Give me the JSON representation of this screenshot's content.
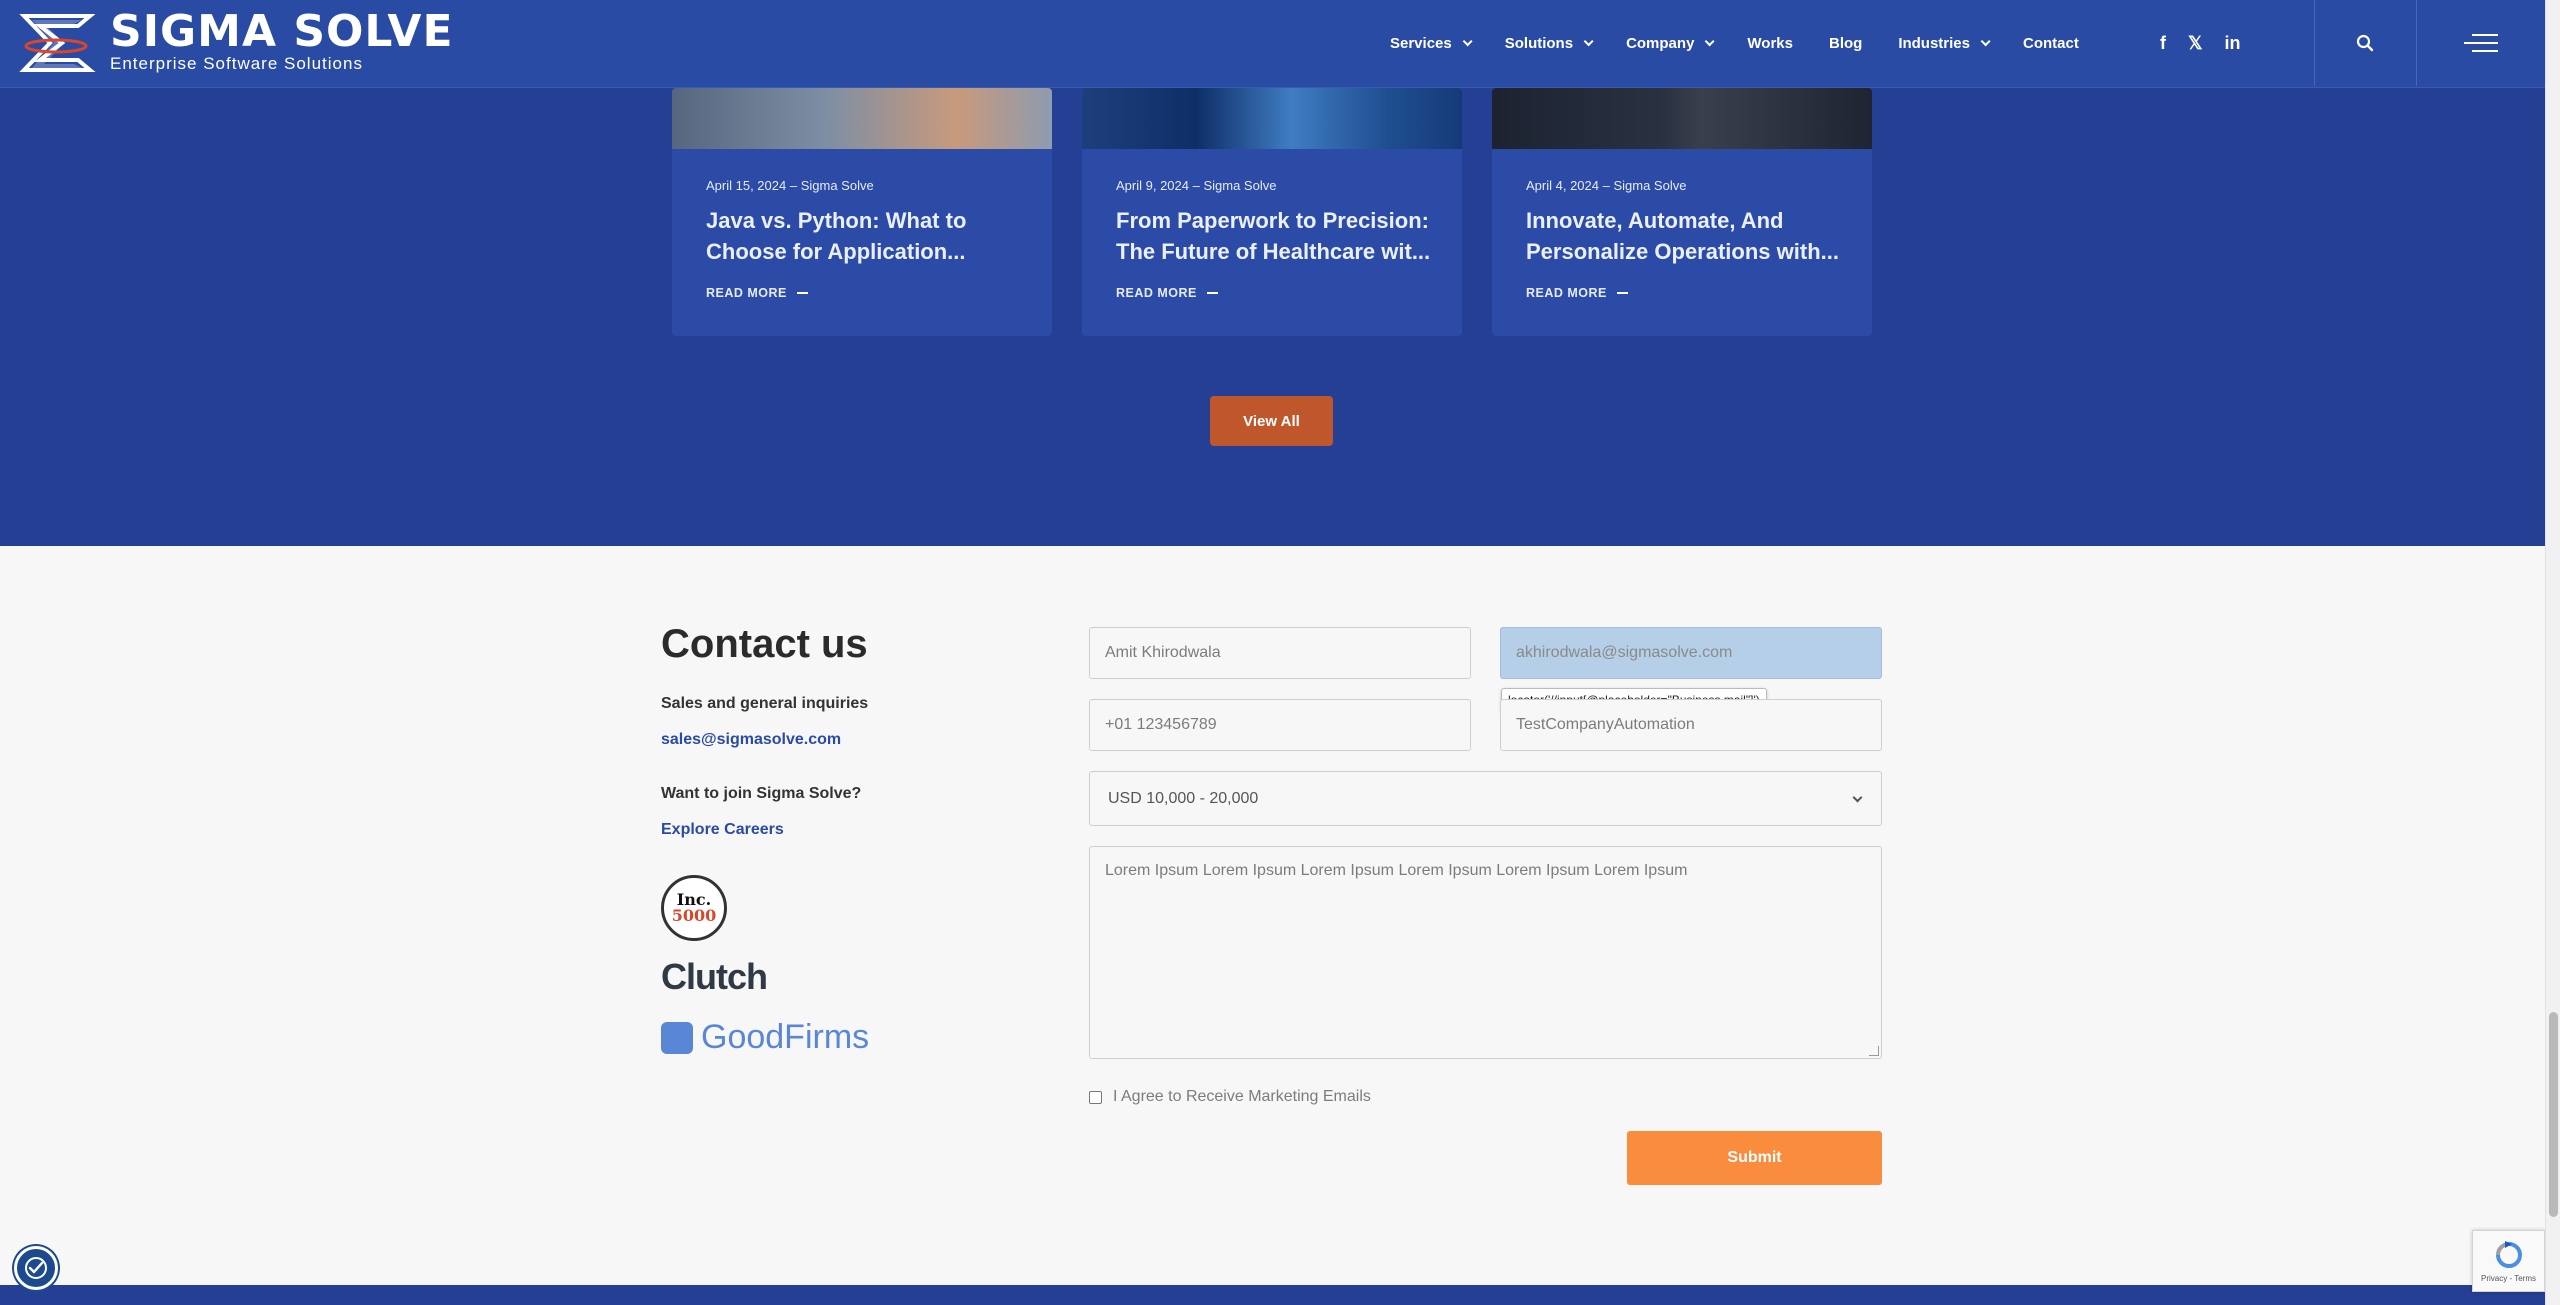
{
  "header": {
    "logo_title": "SIGMA SOLVE",
    "logo_subtitle": "Enterprise Software Solutions",
    "nav": [
      {
        "label": "Services",
        "dropdown": true
      },
      {
        "label": "Solutions",
        "dropdown": true
      },
      {
        "label": "Company",
        "dropdown": true
      },
      {
        "label": "Works",
        "dropdown": false
      },
      {
        "label": "Blog",
        "dropdown": false
      },
      {
        "label": "Industries",
        "dropdown": true
      },
      {
        "label": "Contact",
        "dropdown": false
      }
    ],
    "social": {
      "facebook": "f",
      "x": "𝕏",
      "linkedin": "in"
    },
    "icons": [
      "facebook-icon",
      "x-icon",
      "linkedin-icon",
      "search-icon",
      "hamburger-menu-icon"
    ]
  },
  "blog": {
    "cards": [
      {
        "date": "April 15, 2024",
        "author": "Sigma Solve",
        "title_line1": "Java vs. Python: What to",
        "title_line2": "Choose for Application...",
        "read_more": "READ MORE"
      },
      {
        "date": "April 9, 2024",
        "author": "Sigma Solve",
        "title_line1": "From Paperwork to Precision:",
        "title_line2": "The Future of Healthcare wit...",
        "read_more": "READ MORE"
      },
      {
        "date": "April 4, 2024",
        "author": "Sigma Solve",
        "title_line1": "Innovate, Automate, And",
        "title_line2": "Personalize Operations with...",
        "read_more": "READ MORE"
      }
    ],
    "view_all": "View All"
  },
  "contact": {
    "title": "Contact us",
    "sales_label": "Sales and general inquiries",
    "sales_email": "sales@sigmasolve.com",
    "careers_label": "Want to join Sigma Solve?",
    "careers_link": "Explore Careers",
    "badges": {
      "inc_top": "Inc.",
      "inc_bottom": "5000",
      "clutch": "Clutch",
      "goodfirms": "GoodFirms"
    }
  },
  "form": {
    "name_value": "Amit Khirodwala",
    "email_value": "akhirodwala@sigmasolve.com",
    "phone_value": "+01 123456789",
    "company_value": "TestCompanyAutomation",
    "budget_selected": "USD 10,000 - 20,000",
    "message_value": "Lorem Ipsum Lorem Ipsum Lorem Ipsum Lorem Ipsum Lorem Ipsum Lorem Ipsum",
    "tooltip": "locator('//input[@placeholder=\"Business mail\"]')",
    "agree_label": "I Agree to Receive Marketing Emails",
    "agree_checked": false,
    "submit_label": "Submit"
  },
  "recaptcha": {
    "text": "Privacy - Terms"
  },
  "colors": {
    "header_bg": "#2a4ba3",
    "blog_bg": "#243f94",
    "card_bg": "#2c4ba7",
    "view_all": "#c0562c",
    "submit": "#f98c3d",
    "active_field": "#b6cfe8"
  }
}
